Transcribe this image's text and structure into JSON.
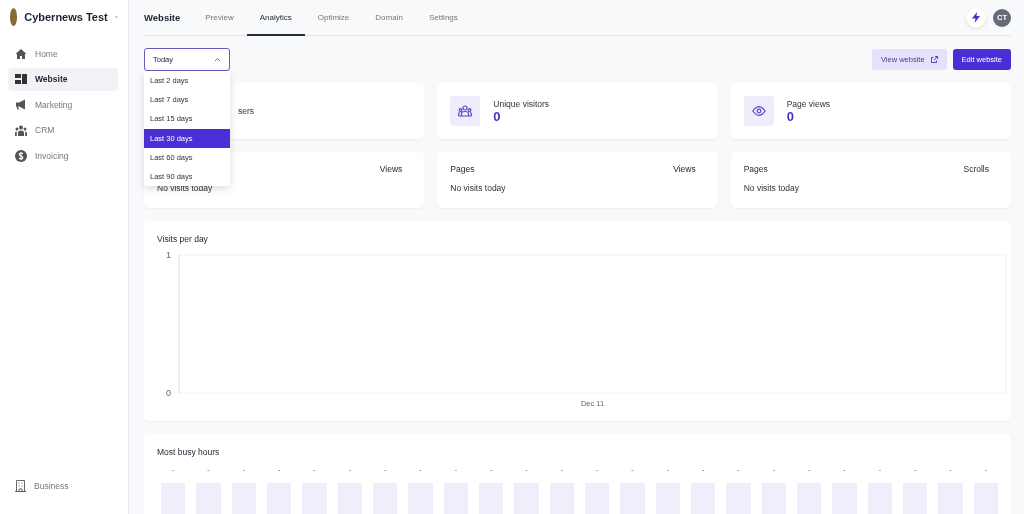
{
  "sidebar": {
    "workspace": "Cybernews Test",
    "items": [
      {
        "label": "Home",
        "kind": "home",
        "selected": false
      },
      {
        "label": "Website",
        "kind": "website",
        "selected": true
      },
      {
        "label": "Marketing",
        "kind": "megaphone",
        "selected": false
      },
      {
        "label": "CRM",
        "kind": "people",
        "selected": false
      },
      {
        "label": "Invoicing",
        "kind": "dollar",
        "selected": false
      }
    ],
    "footer_item": {
      "label": "Business",
      "kind": "building"
    }
  },
  "header": {
    "title": "Website",
    "tabs": [
      {
        "label": "Preview",
        "selected": false
      },
      {
        "label": "Analytics",
        "selected": true
      },
      {
        "label": "Optimize",
        "selected": false
      },
      {
        "label": "Domain",
        "selected": false
      },
      {
        "label": "Settings",
        "selected": false
      }
    ],
    "avatar": "CT"
  },
  "range_select": {
    "value": "Today",
    "expanded": true,
    "options": [
      {
        "label": "Last 2 days",
        "selected": false
      },
      {
        "label": "Last 7 days",
        "selected": false
      },
      {
        "label": "Last 15 days",
        "selected": false
      },
      {
        "label": "Last 30 days",
        "selected": true
      },
      {
        "label": "Last 60 days",
        "selected": false
      },
      {
        "label": "Last 90 days",
        "selected": false
      }
    ]
  },
  "actions": {
    "view_website": "View website",
    "edit_website": "Edit website"
  },
  "stats": [
    {
      "kind": "hidden",
      "label": "sers"
    },
    {
      "kind": "people",
      "label": "Unique visitors",
      "value": "0"
    },
    {
      "kind": "eye",
      "label": "Page views",
      "value": "0"
    }
  ],
  "tables": [
    {
      "column_2": "Views",
      "empty_text": "No visits today"
    },
    {
      "column_1": "Pages",
      "column_2": "Views",
      "empty_text": "No visits today"
    },
    {
      "column_1": "Pages",
      "column_2": "Scrolls",
      "empty_text": "No visits today"
    }
  ],
  "visits_chart": {
    "title": "Visits per day",
    "y_axis_labels": [
      "1",
      "0"
    ],
    "x_axis_labels": [
      "Dec 11"
    ]
  },
  "busy_hours": {
    "title": "Most busy hours",
    "bars": [
      {
        "label": "-"
      },
      {
        "label": "-"
      },
      {
        "label": "-"
      },
      {
        "label": "-"
      },
      {
        "label": "-"
      },
      {
        "label": "-"
      },
      {
        "label": "-"
      },
      {
        "label": "-"
      },
      {
        "label": "-"
      },
      {
        "label": "-"
      },
      {
        "label": "-"
      },
      {
        "label": "-"
      },
      {
        "label": "-"
      },
      {
        "label": "-"
      },
      {
        "label": "-"
      },
      {
        "label": "-"
      },
      {
        "label": "-"
      },
      {
        "label": "-"
      },
      {
        "label": "-"
      },
      {
        "label": "-"
      },
      {
        "label": "-"
      },
      {
        "label": "-"
      },
      {
        "label": "-"
      },
      {
        "label": "-"
      }
    ]
  }
}
